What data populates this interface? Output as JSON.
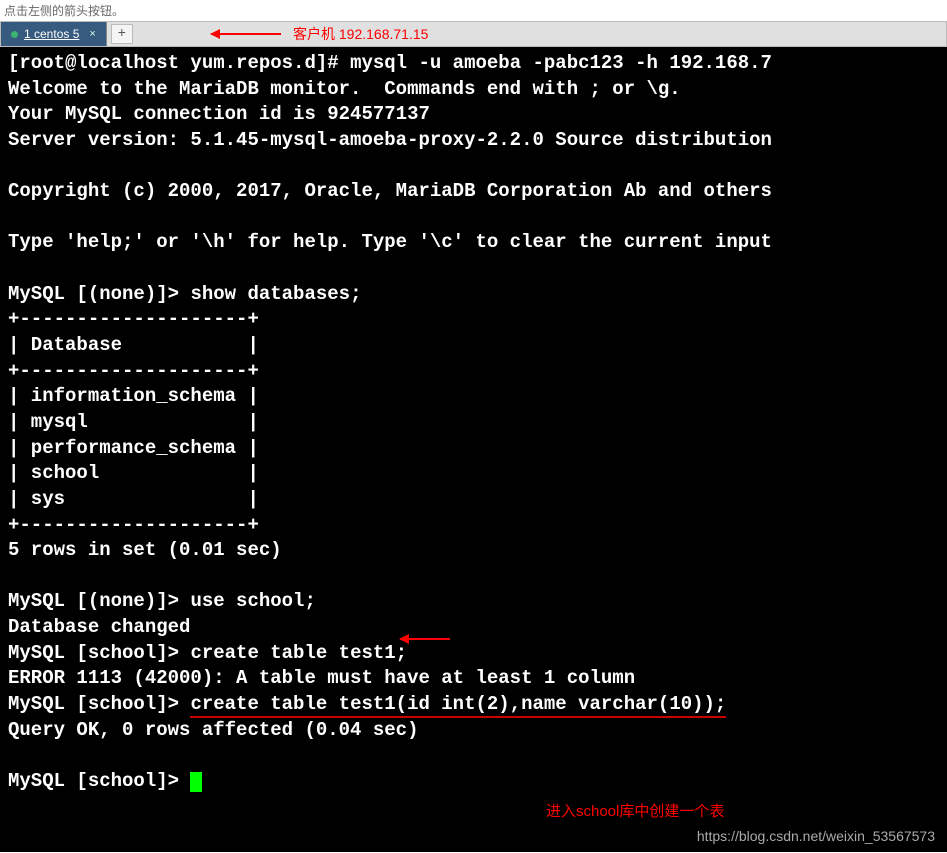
{
  "header_hint": "点击左侧的箭头按钮。",
  "tab": {
    "label": "1 centos 5"
  },
  "annotation_top": "客户机 192.168.71.15",
  "annotation_mid_note": "进入school库中创建一个表",
  "watermark": "https://blog.csdn.net/weixin_53567573",
  "term": {
    "l01_prompt": "[root@localhost yum.repos.d]# ",
    "l01_cmd": "mysql -u amoeba -pabc123 -h 192.168.7",
    "l02": "Welcome to the MariaDB monitor.  Commands end with ; or \\g.",
    "l03": "Your MySQL connection id is 924577137",
    "l04": "Server version: 5.1.45-mysql-amoeba-proxy-2.2.0 Source distribution",
    "l05": "",
    "l06": "Copyright (c) 2000, 2017, Oracle, MariaDB Corporation Ab and others",
    "l07": "",
    "l08": "Type 'help;' or '\\h' for help. Type '\\c' to clear the current input",
    "l09": "",
    "l10_prompt": "MySQL [(none)]> ",
    "l10_cmd": "show databases;",
    "l11": "+--------------------+",
    "l12": "| Database           |",
    "l13": "+--------------------+",
    "l14": "| information_schema |",
    "l15": "| mysql              |",
    "l16": "| performance_schema |",
    "l17": "| school             |",
    "l18": "| sys                |",
    "l19": "+--------------------+",
    "l20": "5 rows in set (0.01 sec)",
    "l21": "",
    "l22_prompt": "MySQL [(none)]> ",
    "l22_cmd": "use school;",
    "l23": "Database changed",
    "l24_prompt": "MySQL [school]> ",
    "l24_cmd": "create table test1;",
    "l25": "ERROR 1113 (42000): A table must have at least 1 column",
    "l26_prompt": "MySQL [school]> ",
    "l26_cmd": "create table test1(id int(2),name varchar(10));",
    "l27": "Query OK, 0 rows affected (0.04 sec)",
    "l28": "",
    "l29_prompt": "MySQL [school]> "
  }
}
